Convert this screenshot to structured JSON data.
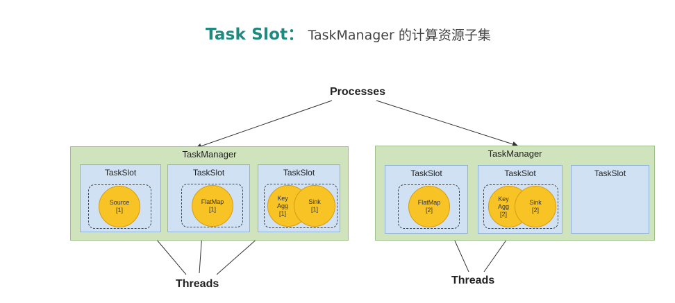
{
  "title": {
    "main": "Task Slot：",
    "sub": "TaskManager 的计算资源子集"
  },
  "labels": {
    "processes": "Processes",
    "threads": "Threads"
  },
  "task_managers": [
    {
      "label": "TaskManager",
      "slots": [
        {
          "label": "TaskSlot",
          "operators": [
            {
              "name": "Source",
              "index": "[1]"
            }
          ]
        },
        {
          "label": "TaskSlot",
          "operators": [
            {
              "name": "FlatMap",
              "index": "[1]"
            }
          ]
        },
        {
          "label": "TaskSlot",
          "operators": [
            {
              "name": "Key Agg",
              "index": "[1]"
            },
            {
              "name": "Sink",
              "index": "[1]"
            }
          ]
        }
      ]
    },
    {
      "label": "TaskManager",
      "slots": [
        {
          "label": "TaskSlot",
          "operators": [
            {
              "name": "FlatMap",
              "index": "[2]"
            }
          ]
        },
        {
          "label": "TaskSlot",
          "operators": [
            {
              "name": "Key Agg",
              "index": "[2]"
            },
            {
              "name": "Sink",
              "index": "[2]"
            }
          ]
        },
        {
          "label": "TaskSlot",
          "operators": []
        }
      ]
    }
  ],
  "colors": {
    "title_accent": "#1e8a7f",
    "task_manager_fill": "#cfe3bd",
    "task_slot_fill": "#cfe1f3",
    "operator_fill": "#f7c325"
  }
}
